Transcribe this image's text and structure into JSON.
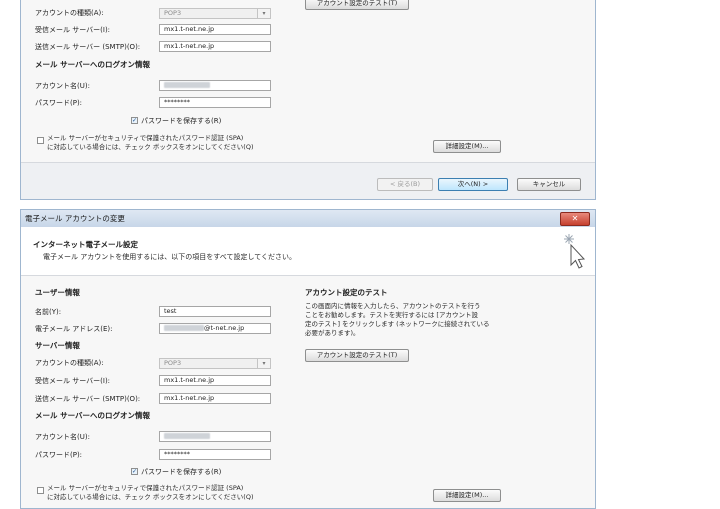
{
  "window1": {
    "account_type_label": "アカウントの種類(A):",
    "account_type_value": "POP3",
    "incoming_label": "受信メール サーバー(I):",
    "incoming_value": "mx1.t-net.ne.jp",
    "outgoing_label": "送信メール サーバー (SMTP)(O):",
    "outgoing_value": "mx1.t-net.ne.jp",
    "logon_section": "メール サーバーへのログオン情報",
    "account_name_label": "アカウント名(U):",
    "password_label": "パスワード(P):",
    "password_value": "********",
    "remember_password": "パスワードを保存する(R)",
    "spa_line1": "メール サーバーがセキュリティで保護されたパスワード認証 (SPA)",
    "spa_line2": "に対応している場合には、チェック ボックスをオンにしてください(Q)",
    "test_button": "アカウント設定のテスト(T)",
    "advanced_button": "詳細設定(M)...",
    "back_button": "< 戻る(B)",
    "next_button": "次へ(N) >",
    "cancel_button": "キャンセル"
  },
  "window2": {
    "title": "電子メール アカウントの変更",
    "close_glyph": "✕",
    "header_title": "インターネット電子メール設定",
    "header_subtitle": "電子メール アカウントを使用するには、以下の項目をすべて設定してください。",
    "user_section": "ユーザー情報",
    "name_label": "名前(Y):",
    "name_value": "test",
    "email_label": "電子メール アドレス(E):",
    "email_suffix": "@t-net.ne.jp",
    "server_section": "サーバー情報",
    "account_type_label": "アカウントの種類(A):",
    "account_type_value": "POP3",
    "incoming_label": "受信メール サーバー(I):",
    "incoming_value": "mx1.t-net.ne.jp",
    "outgoing_label": "送信メール サーバー (SMTP)(O):",
    "outgoing_value": "mx1.t-net.ne.jp",
    "logon_section": "メール サーバーへのログオン情報",
    "account_name_label": "アカウント名(U):",
    "password_label": "パスワード(P):",
    "password_value": "********",
    "remember_password": "パスワードを保存する(R)",
    "spa_line1": "メール サーバーがセキュリティで保護されたパスワード認証 (SPA)",
    "spa_line2": "に対応している場合には、チェック ボックスをオンにしてください(Q)",
    "test_section": "アカウント設定のテスト",
    "test_desc": [
      "この画面内に情報を入力したら、アカウントのテストを行う",
      "ことをお勧めします。テストを実行するには [アカウント設",
      "定のテスト] をクリックします (ネットワークに接続されている",
      "必要があります)。"
    ],
    "test_button": "アカウント設定のテスト(T)",
    "advanced_button": "詳細設定(M)..."
  },
  "icons": {
    "dropdown": "chevron-down-icon",
    "check": "checkmark-icon",
    "header": "sparkle-cursor-icon"
  }
}
